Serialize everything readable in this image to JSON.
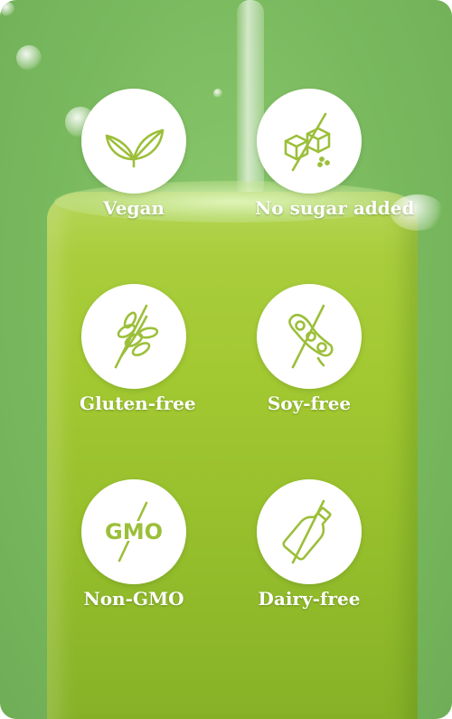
{
  "badges": [
    {
      "label": "Vegan",
      "icon": "leaves-icon"
    },
    {
      "label": "No sugar added",
      "icon": "sugar-cubes-crossed-icon"
    },
    {
      "label": "Gluten-free",
      "icon": "wheat-crossed-icon"
    },
    {
      "label": "Soy-free",
      "icon": "soybean-crossed-icon"
    },
    {
      "label": "GMO",
      "caption": "Non-GMO",
      "icon": "gmo-crossed-icon"
    },
    {
      "label": "Dairy-free",
      "icon": "milk-bottle-crossed-icon"
    }
  ],
  "colors": {
    "background": "#79b95e",
    "juice": "#a2c831",
    "icon_stroke": "#9cbf3a",
    "label": "#ffffff"
  }
}
